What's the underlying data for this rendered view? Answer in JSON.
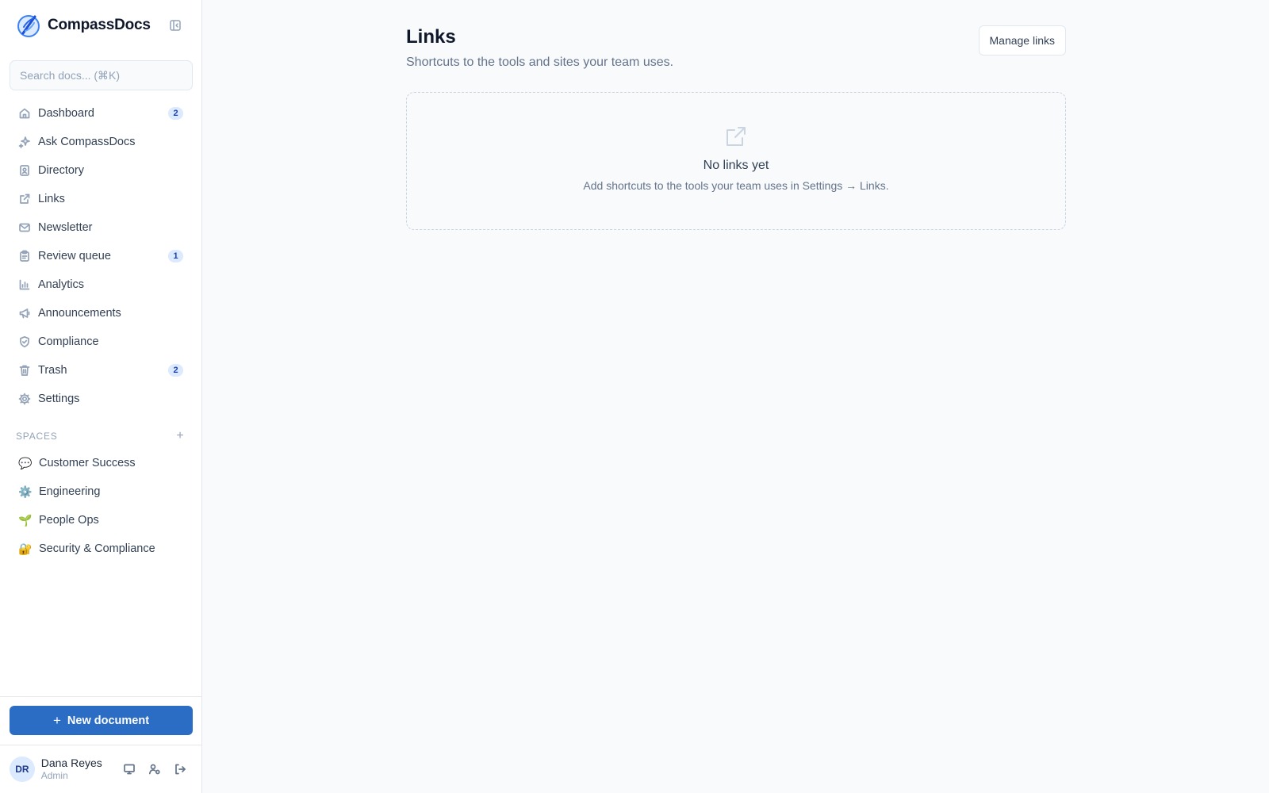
{
  "app": {
    "name": "CompassDocs"
  },
  "search": {
    "placeholder": "Search docs... (⌘K)"
  },
  "nav": {
    "items": [
      {
        "label": "Dashboard",
        "badge": "2",
        "icon": "home-icon"
      },
      {
        "label": "Ask CompassDocs",
        "icon": "sparkles-icon"
      },
      {
        "label": "Directory",
        "icon": "contact-book-icon"
      },
      {
        "label": "Links",
        "icon": "external-link-icon"
      },
      {
        "label": "Newsletter",
        "icon": "mail-icon"
      },
      {
        "label": "Review queue",
        "badge": "1",
        "icon": "clipboard-icon"
      },
      {
        "label": "Analytics",
        "icon": "bar-chart-icon"
      },
      {
        "label": "Announcements",
        "icon": "megaphone-icon"
      },
      {
        "label": "Compliance",
        "icon": "shield-check-icon"
      },
      {
        "label": "Trash",
        "badge": "2",
        "icon": "trash-icon"
      },
      {
        "label": "Settings",
        "icon": "gear-icon"
      }
    ]
  },
  "spaces": {
    "title": "SPACES",
    "add": "+",
    "items": [
      {
        "emoji": "💬",
        "label": "Customer Success"
      },
      {
        "emoji": "⚙️",
        "label": "Engineering"
      },
      {
        "emoji": "🌱",
        "label": "People Ops"
      },
      {
        "emoji": "🔐",
        "label": "Security & Compliance"
      }
    ]
  },
  "new_document": {
    "plus": "+",
    "label": "New document"
  },
  "user": {
    "initials": "DR",
    "name": "Dana Reyes",
    "role": "Admin"
  },
  "main": {
    "title": "Links",
    "subtitle": "Shortcuts to the tools and sites your team uses.",
    "manage_button": "Manage links",
    "empty": {
      "title": "No links yet",
      "description": "Add shortcuts to the tools your team uses in Settings → Links."
    }
  },
  "colors": {
    "accent": "#2b6cc4",
    "badge_bg": "#dbeafe",
    "badge_text": "#1e40af"
  }
}
